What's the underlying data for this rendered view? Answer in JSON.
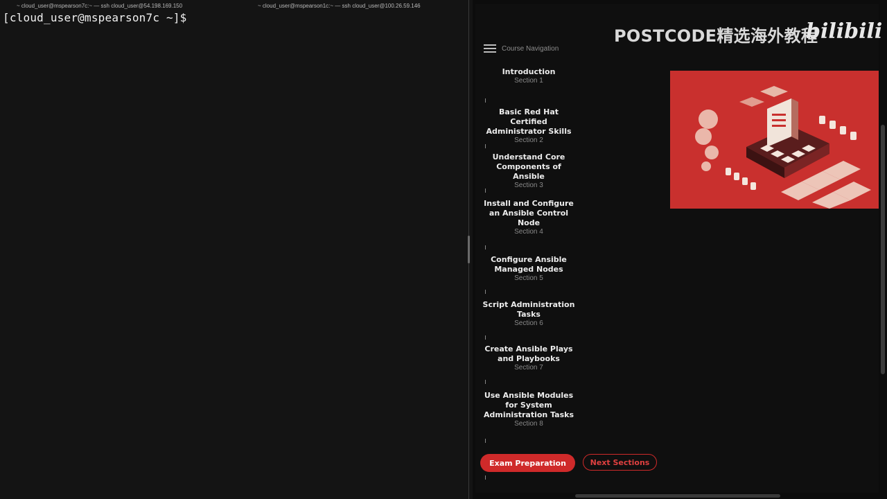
{
  "terminal": {
    "tabs": [
      "~ cloud_user@mspearson7c:~ — ssh cloud_user@54.198.169.150",
      "~ cloud_user@mspearson1c:~ — ssh cloud_user@100.26.59.146"
    ],
    "prompt": "[cloud_user@mspearson7c ~]$"
  },
  "course": {
    "nav_label": "Course Navigation",
    "sections": [
      {
        "title": "Introduction",
        "subtitle": "Section 1"
      },
      {
        "title": "Basic Red Hat Certified Administrator Skills",
        "subtitle": "Section 2"
      },
      {
        "title": "Understand Core Components of Ansible",
        "subtitle": "Section 3"
      },
      {
        "title": "Install and Configure an Ansible Control Node",
        "subtitle": "Section 4"
      },
      {
        "title": "Configure Ansible Managed Nodes",
        "subtitle": "Section 5"
      },
      {
        "title": "Script Administration Tasks",
        "subtitle": "Section 6"
      },
      {
        "title": "Create Ansible Plays and Playbooks",
        "subtitle": "Section 7"
      },
      {
        "title": "Use Ansible Modules for System Administration Tasks",
        "subtitle": "Section 8"
      }
    ],
    "buttons": {
      "exam_preparation": "Exam Preparation",
      "next_sections": "Next Sections"
    }
  },
  "watermark": {
    "text": "POSTCODE精选海外教程",
    "logo": "bilibili"
  },
  "colors": {
    "accent_red": "#cf2a2a",
    "hero_bg": "#c9302e",
    "terminal_bg": "#141414"
  }
}
